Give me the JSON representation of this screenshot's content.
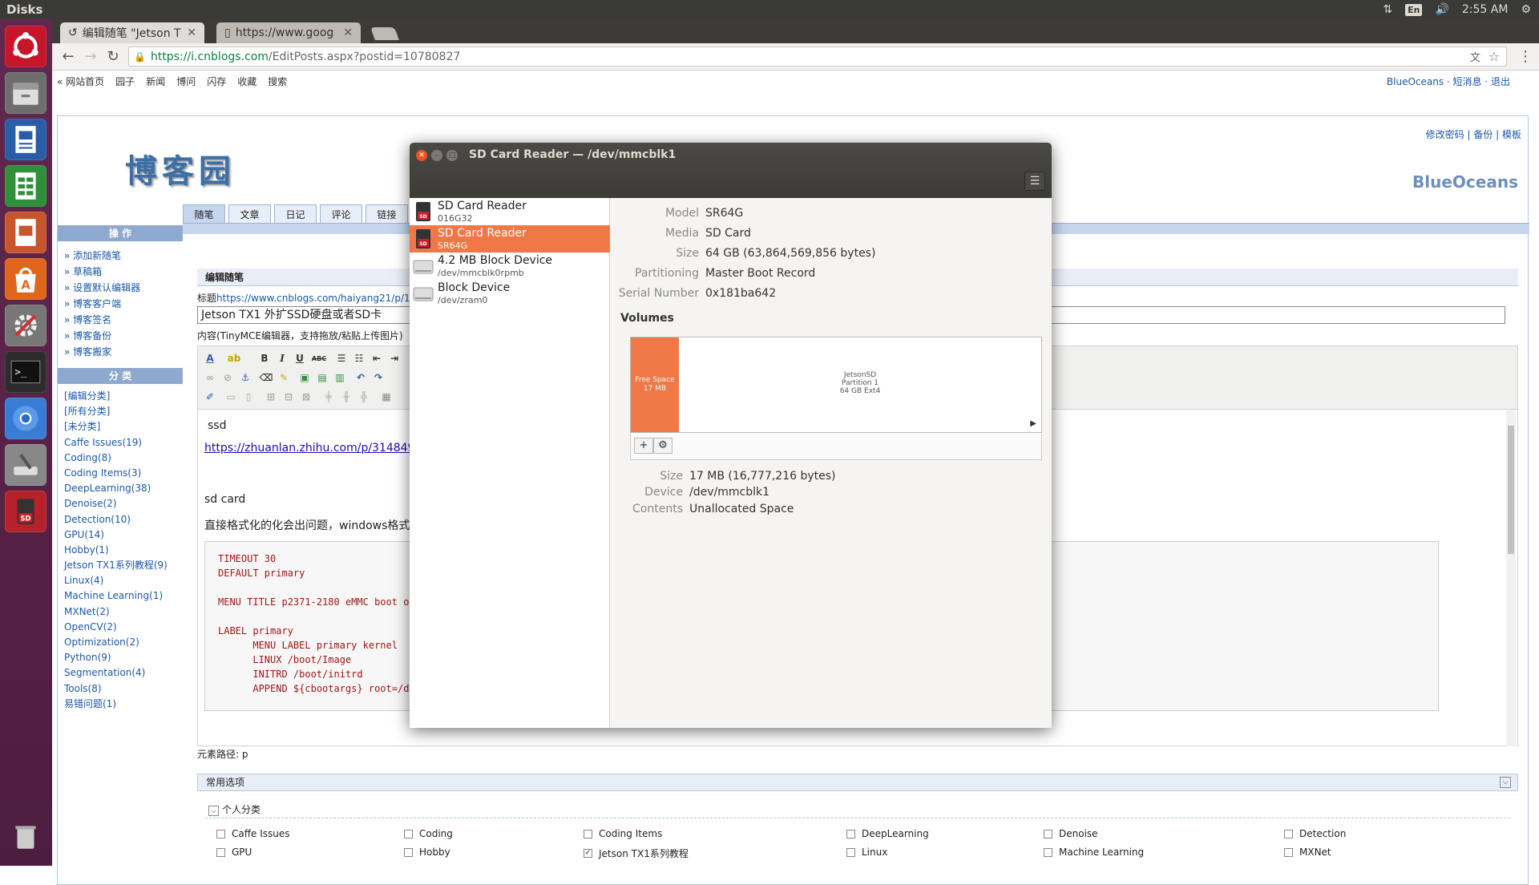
{
  "panel": {
    "app": "Disks",
    "lang": "En",
    "time": "2:55 AM"
  },
  "browser": {
    "tabs": [
      {
        "label": "编辑随笔 \"Jetson T"
      },
      {
        "label": "https://www.goog"
      }
    ],
    "url_host": "https://i.cnblogs.com",
    "url_path": "/EditPosts.aspx?postid=10780827",
    "sitebar": [
      "« 网站首页",
      "园子",
      "新闻",
      "博问",
      "闪存",
      "收藏",
      "搜索"
    ],
    "sitebar_right": "BlueOceans · 短消息 · 退出"
  },
  "blog": {
    "logo": "博客园",
    "toplinks": "修改密码 | 备份 | 模板",
    "name": "BlueOceans",
    "tabs": [
      "随笔",
      "文章",
      "日记",
      "评论",
      "链接"
    ],
    "ops_head": "操 作",
    "ops": [
      "» 添加新随笔",
      "» 草稿箱",
      "» 设置默认编辑器",
      "» 博客客户端",
      "» 博客签名",
      "» 博客备份",
      "» 博客搬家"
    ],
    "cats_head": "分 类",
    "cats": [
      "[编辑分类]",
      "[所有分类]",
      "[未分类]",
      "Caffe Issues(19)",
      "Coding(8)",
      "Coding Items(3)",
      "DeepLearning(38)",
      "Denoise(2)",
      "Detection(10)",
      "GPU(14)",
      "Hobby(1)",
      "Jetson TX1系列教程(9)",
      "Linux(4)",
      "Machine Learning(1)",
      "MXNet(2)",
      "OpenCV(2)",
      "Optimization(2)",
      "Python(9)",
      "Segmentation(4)",
      "Tools(8)",
      "易错问题(1)"
    ],
    "edit_head": "编辑随笔",
    "title_label": "标题",
    "title_link": "https://www.cnblogs.com/haiyang21/p/107808",
    "title_value": "Jetson TX1 外扩SSD硬盘或者SD卡",
    "content_label": "内容(TinyMCE编辑器，支持拖放/粘贴上传图片)",
    "editor": {
      "p1": "ssd",
      "link": "https://zhuanlan.zhihu.com/p/31484956",
      "p2": "sd card",
      "p3": "直接格式化的化会出问题，windows格式化",
      "code": "TIMEOUT 30\nDEFAULT primary\n\nMENU TITLE p2371-2180 eMMC boot op\n\nLABEL primary\n      MENU LABEL primary kernel\n      LINUX /boot/Image\n      INITRD /boot/initrd\n      APPEND ${cbootargs} root=/de"
    },
    "path_label": "元素路径: p",
    "common_head": "常用选项",
    "personal_head": "个人分类",
    "checkboxes": [
      {
        "label": "Caffe Issues",
        "checked": false
      },
      {
        "label": "Coding",
        "checked": false
      },
      {
        "label": "Coding Items",
        "checked": false
      },
      {
        "label": "DeepLearning",
        "checked": false
      },
      {
        "label": "Denoise",
        "checked": false
      },
      {
        "label": "Detection",
        "checked": false
      },
      {
        "label": "GPU",
        "checked": false
      },
      {
        "label": "Hobby",
        "checked": false
      },
      {
        "label": "Jetson TX1系列教程",
        "checked": true
      },
      {
        "label": "Linux",
        "checked": false
      },
      {
        "label": "Machine Learning",
        "checked": false
      },
      {
        "label": "MXNet",
        "checked": false
      }
    ]
  },
  "disks": {
    "title": "SD Card Reader — /dev/mmcblk1",
    "devices": [
      {
        "name": "SD Card Reader",
        "sub": "016G32",
        "icon": "sd-card-icon"
      },
      {
        "name": "SD Card Reader",
        "sub": "SR64G",
        "icon": "sd-card-icon"
      },
      {
        "name": "4.2 MB Block Device",
        "sub": "/dev/mmcblk0rpmb",
        "icon": "drive-icon"
      },
      {
        "name": "Block Device",
        "sub": "/dev/zram0",
        "icon": "drive-icon"
      }
    ],
    "info": [
      {
        "k": "Model",
        "v": "SR64G"
      },
      {
        "k": "Media",
        "v": "SD Card"
      },
      {
        "k": "Size",
        "v": "64 GB (63,864,569,856 bytes)"
      },
      {
        "k": "Partitioning",
        "v": "Master Boot Record"
      },
      {
        "k": "Serial Number",
        "v": "0x181ba642"
      }
    ],
    "volumes_label": "Volumes",
    "free_seg": {
      "l1": "Free Space",
      "l2": "17 MB"
    },
    "part_seg": {
      "l1": "JetsonSD",
      "l2": "Partition 1",
      "l3": "64 GB Ext4"
    },
    "vol_info": [
      {
        "k": "Size",
        "v": "17 MB (16,777,216 bytes)"
      },
      {
        "k": "Device",
        "v": "/dev/mmcblk1"
      },
      {
        "k": "Contents",
        "v": "Unallocated Space"
      }
    ]
  }
}
